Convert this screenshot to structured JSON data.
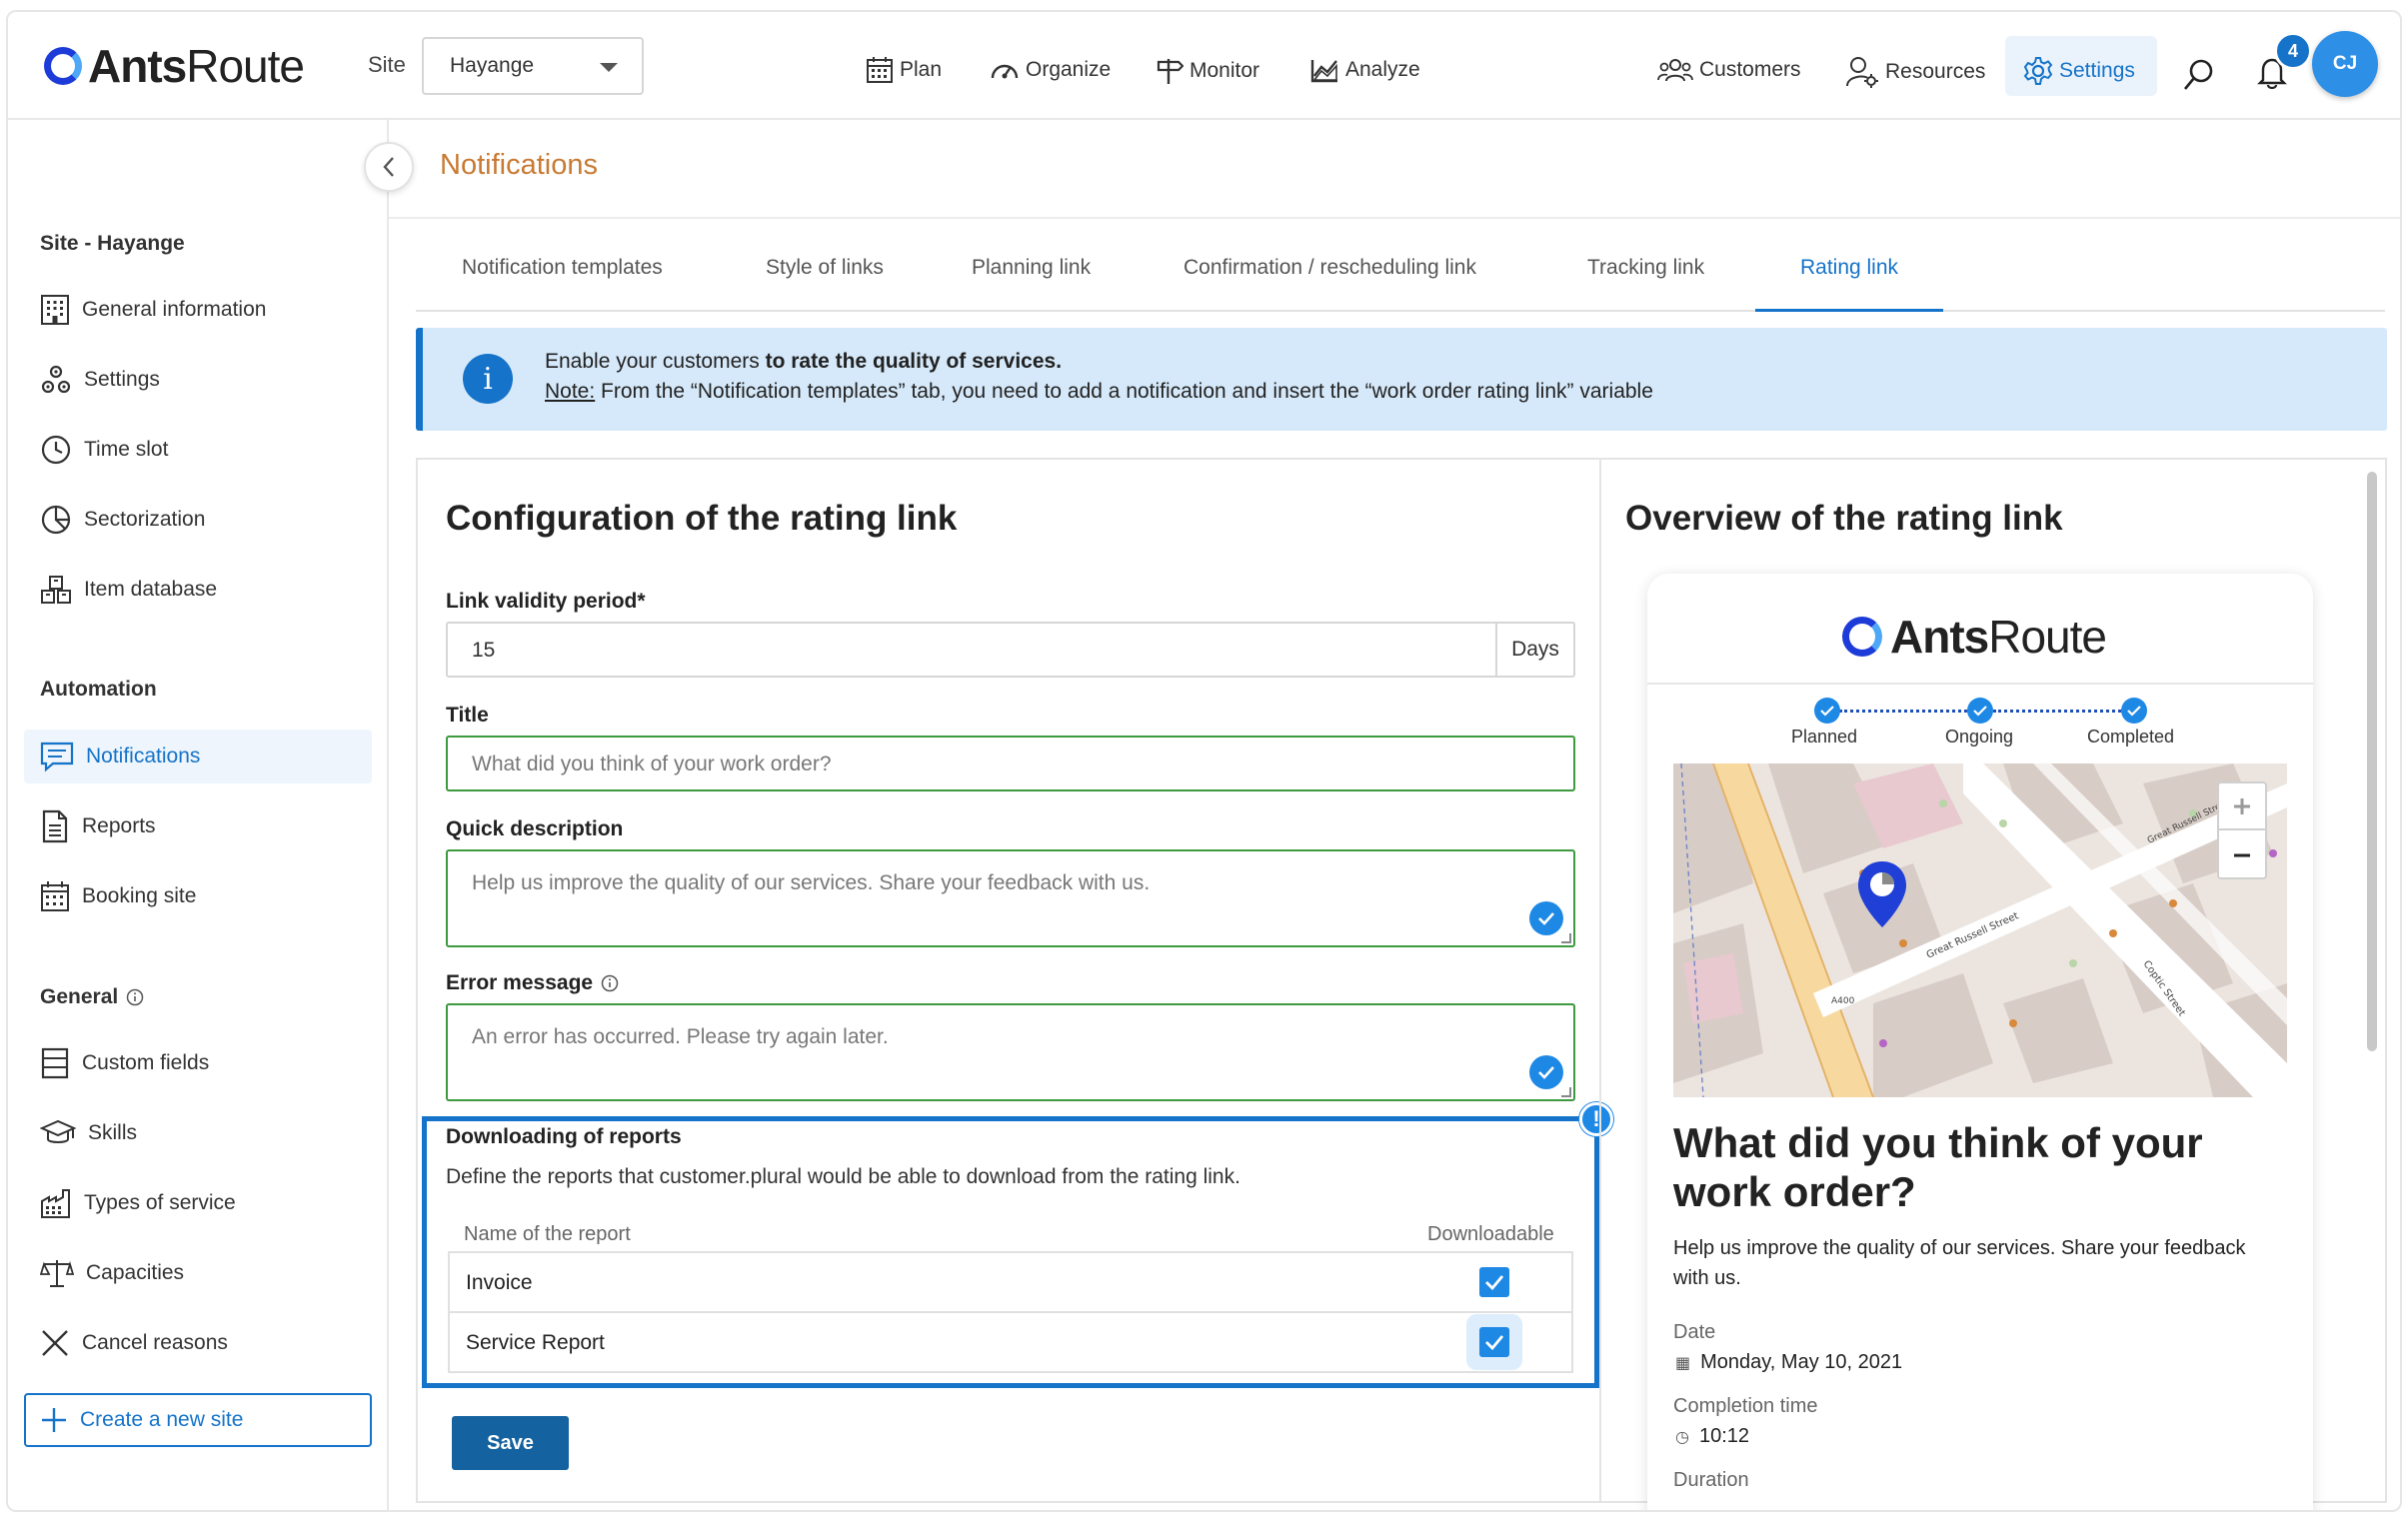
{
  "brand": {
    "name_bold": "Ants",
    "name_regular": "Route"
  },
  "header": {
    "site_label": "Site",
    "site_value": "Hayange",
    "nav": {
      "plan": "Plan",
      "organize": "Organize",
      "monitor": "Monitor",
      "analyze": "Analyze"
    },
    "right": {
      "customers": "Customers",
      "resources": "Resources",
      "settings": "Settings"
    },
    "notification_count": "4",
    "avatar_initials": "CJ"
  },
  "sidebar": {
    "site_heading": "Site - Hayange",
    "site_items": [
      {
        "label": "General information",
        "icon": "building-icon"
      },
      {
        "label": "Settings",
        "icon": "gears-icon"
      },
      {
        "label": "Time slot",
        "icon": "clock-icon"
      },
      {
        "label": "Sectorization",
        "icon": "pie-icon"
      },
      {
        "label": "Item database",
        "icon": "boxes-icon"
      }
    ],
    "automation_heading": "Automation",
    "automation_items": [
      {
        "label": "Notifications",
        "icon": "chat-icon",
        "active": true
      },
      {
        "label": "Reports",
        "icon": "document-icon"
      },
      {
        "label": "Booking site",
        "icon": "calendar-icon"
      }
    ],
    "general_heading": "General",
    "general_items": [
      {
        "label": "Custom fields",
        "icon": "fields-icon"
      },
      {
        "label": "Skills",
        "icon": "graduation-cap-icon"
      },
      {
        "label": "Types of service",
        "icon": "factory-icon"
      },
      {
        "label": "Capacities",
        "icon": "scale-icon"
      },
      {
        "label": "Cancel reasons",
        "icon": "x-icon"
      }
    ],
    "create_site": "Create a new site"
  },
  "page": {
    "title": "Notifications",
    "tabs": [
      {
        "label": "Notification templates"
      },
      {
        "label": "Style of links"
      },
      {
        "label": "Planning link"
      },
      {
        "label": "Confirmation / rescheduling link"
      },
      {
        "label": "Tracking link"
      },
      {
        "label": "Rating link",
        "active": true
      }
    ],
    "info": {
      "line1_prefix": "Enable your customers ",
      "line1_bold": "to rate the quality of services.",
      "note_label": "Note:",
      "line2": " From the “Notification templates” tab, you need to add a notification and insert the “work order rating link” variable"
    }
  },
  "config": {
    "title": "Configuration of the rating link",
    "validity_label": "Link validity period*",
    "validity_value": "15",
    "validity_unit": "Days",
    "title_label": "Title",
    "title_value": "What did you think of your work order?",
    "description_label": "Quick description",
    "description_value": "Help us improve the quality of our services. Share your feedback with us.",
    "error_label": "Error message",
    "error_value": "An error has occurred. Please try again later.",
    "download": {
      "heading": "Downloading of reports",
      "description": "Define the reports that customer.plural would be able to download from the rating link.",
      "col_name": "Name of the report",
      "col_downloadable": "Downloadable",
      "rows": [
        {
          "name": "Invoice",
          "checked": true
        },
        {
          "name": "Service Report",
          "checked": true
        }
      ],
      "alert": "!"
    },
    "save": "Save"
  },
  "overview": {
    "title": "Overview of the rating link",
    "steps": [
      "Planned",
      "Ongoing",
      "Completed"
    ],
    "heading": "What did you think of your work order?",
    "description": "Help us improve the quality of our services. Share your feedback with us.",
    "date_label": "Date",
    "date_value": "Monday, May 10, 2021",
    "completion_label": "Completion time",
    "completion_value": "10:12",
    "duration_label": "Duration",
    "map": {
      "street_1": "Great Russell Street",
      "street_2": "Coptic Street",
      "road_code": "A400"
    }
  },
  "colors": {
    "accent": "#1573c9",
    "title_orange": "#c87a33",
    "banner": "#d6e9fa",
    "valid_green": "#3e9a3e"
  }
}
